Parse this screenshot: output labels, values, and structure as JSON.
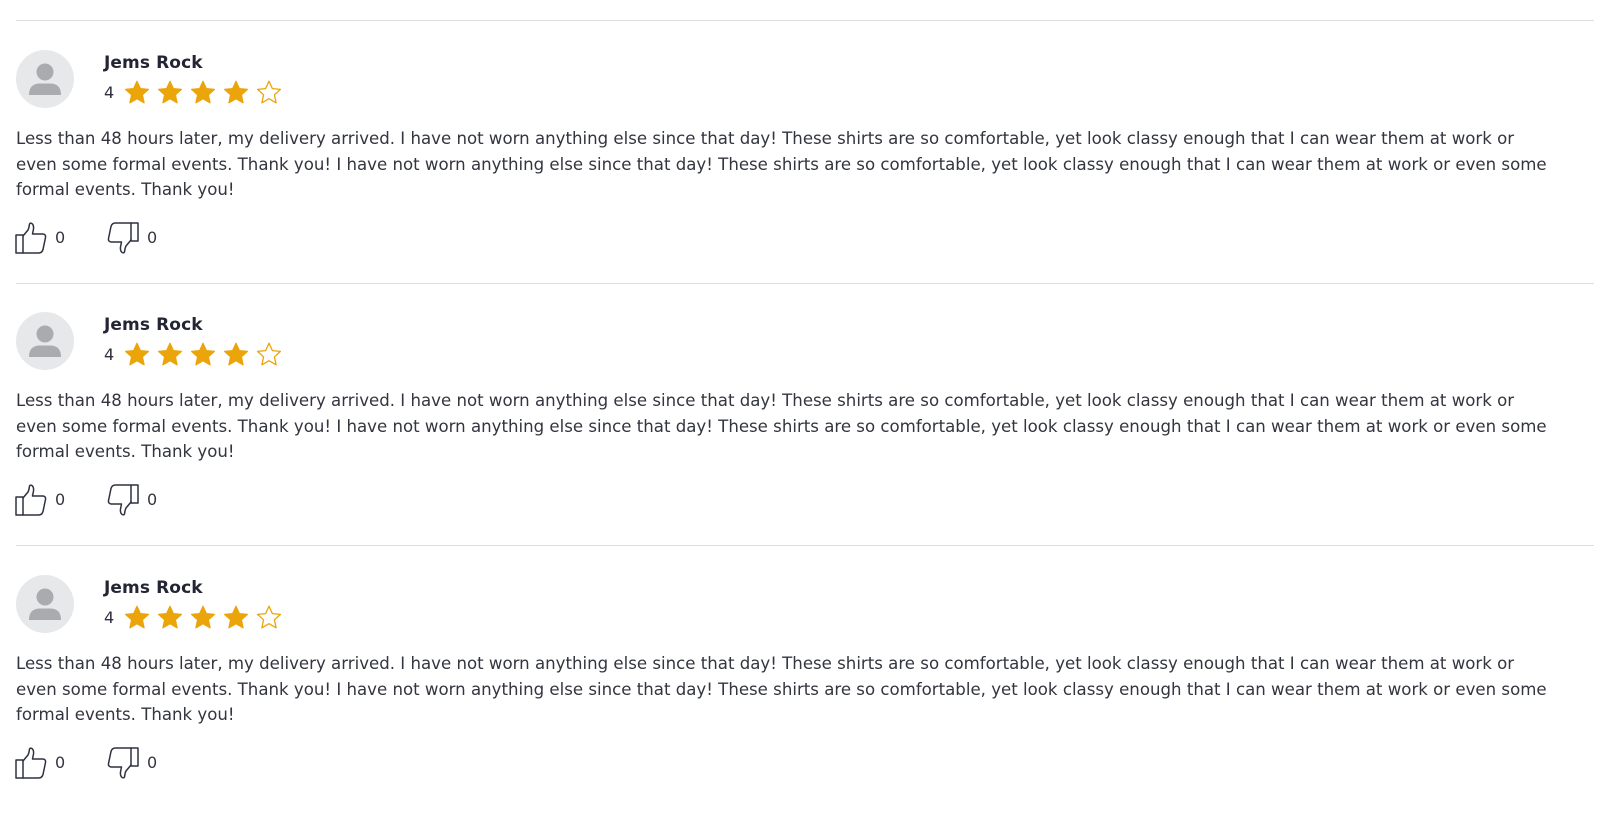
{
  "colors": {
    "star_fill": "#eba40a",
    "star_outline": "#eba40a",
    "divider": "#dedede",
    "avatar_bg": "#e7e8ea",
    "avatar_fg": "#a9abae"
  },
  "reviews": [
    {
      "author": "Jems Rock",
      "rating": "4",
      "rating_value": 4,
      "rating_max": 5,
      "text": "Less than 48 hours later, my delivery arrived. I have not worn anything else since that day! These shirts are so comfortable, yet look classy enough that I can wear them at work or even some formal events. Thank you! I have not worn anything else since that day! These shirts are so comfortable, yet look classy enough that I can wear them at work or even some formal events. Thank you!",
      "likes": "0",
      "dislikes": "0",
      "avatar_icon": "user-avatar-icon",
      "like_icon": "thumbs-up-icon",
      "dislike_icon": "thumbs-down-icon"
    },
    {
      "author": "Jems Rock",
      "rating": "4",
      "rating_value": 4,
      "rating_max": 5,
      "text": "Less than 48 hours later, my delivery arrived. I have not worn anything else since that day! These shirts are so comfortable, yet look classy enough that I can wear them at work or even some formal events. Thank you! I have not worn anything else since that day! These shirts are so comfortable, yet look classy enough that I can wear them at work or even some formal events. Thank you!",
      "likes": "0",
      "dislikes": "0",
      "avatar_icon": "user-avatar-icon",
      "like_icon": "thumbs-up-icon",
      "dislike_icon": "thumbs-down-icon"
    },
    {
      "author": "Jems Rock",
      "rating": "4",
      "rating_value": 4,
      "rating_max": 5,
      "text": "Less than 48 hours later, my delivery arrived. I have not worn anything else since that day! These shirts are so comfortable, yet look classy enough that I can wear them at work or even some formal events. Thank you! I have not worn anything else since that day! These shirts are so comfortable, yet look classy enough that I can wear them at work or even some formal events. Thank you!",
      "likes": "0",
      "dislikes": "0",
      "avatar_icon": "user-avatar-icon",
      "like_icon": "thumbs-up-icon",
      "dislike_icon": "thumbs-down-icon"
    }
  ]
}
